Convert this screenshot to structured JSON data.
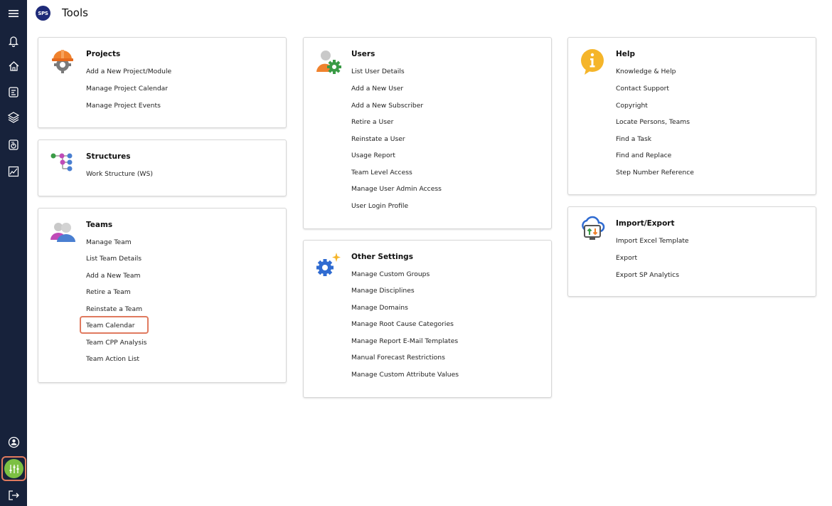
{
  "header": {
    "logo_text": "SPS",
    "title": "Tools"
  },
  "sidebar": {
    "items": [
      {
        "name": "menu-icon"
      },
      {
        "name": "bell-icon"
      },
      {
        "name": "home-icon"
      },
      {
        "name": "document-icon"
      },
      {
        "name": "layers-icon"
      },
      {
        "name": "report-icon"
      },
      {
        "name": "analytics-icon"
      },
      {
        "name": "user-icon"
      },
      {
        "name": "tools-icon",
        "active": true
      },
      {
        "name": "logout-icon"
      }
    ],
    "active_color": "#7cc043",
    "highlight_color": "#e07a5f"
  },
  "cards": {
    "projects": {
      "title": "Projects",
      "links": [
        "Add a New Project/Module",
        "Manage Project Calendar",
        "Manage Project Events"
      ]
    },
    "structures": {
      "title": "Structures",
      "links": [
        "Work Structure (WS)"
      ]
    },
    "teams": {
      "title": "Teams",
      "links": [
        "Manage Team",
        "List Team Details",
        "Add a New Team",
        "Retire a Team",
        "Reinstate a Team",
        "Team Calendar",
        "Team CPP Analysis",
        "Team Action List"
      ],
      "highlighted": "Team Calendar"
    },
    "users": {
      "title": "Users",
      "links": [
        "List User Details",
        "Add a New User",
        "Add a New Subscriber",
        "Retire a User",
        "Reinstate a User",
        "Usage Report",
        "Team Level Access",
        "Manage User Admin Access",
        "User Login Profile"
      ]
    },
    "other_settings": {
      "title": "Other Settings",
      "links": [
        "Manage Custom Groups",
        "Manage Disciplines",
        "Manage Domains",
        "Manage Root Cause Categories",
        "Manage Report E-Mail Templates",
        "Manual Forecast Restrictions",
        "Manage Custom Attribute Values"
      ]
    },
    "help": {
      "title": "Help",
      "links": [
        "Knowledge & Help",
        "Contact Support",
        "Copyright",
        "Locate Persons, Teams",
        "Find a Task",
        "Find and Replace",
        "Step Number Reference"
      ]
    },
    "import_export": {
      "title": "Import/Export",
      "links": [
        "Import Excel Template",
        "Export",
        "Export SP Analytics"
      ]
    }
  }
}
